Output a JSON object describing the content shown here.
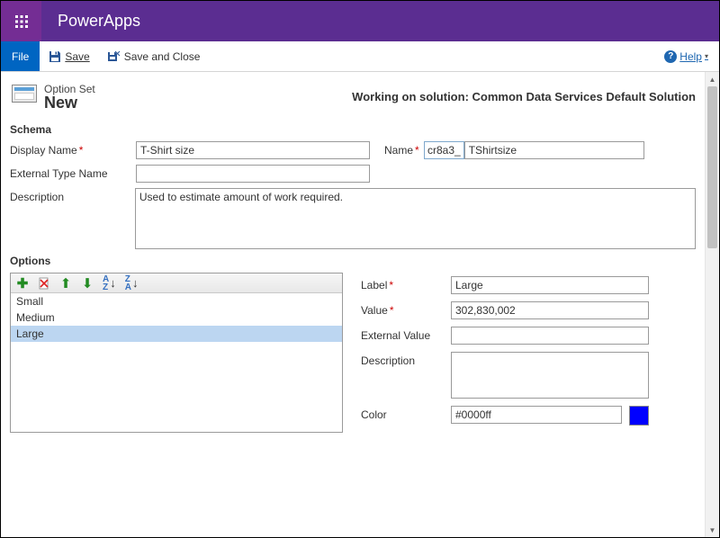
{
  "header": {
    "appTitle": "PowerApps"
  },
  "commandBar": {
    "file": "File",
    "save": "Save",
    "saveAndClose": "Save and Close",
    "help": "Help"
  },
  "pageHead": {
    "type": "Option Set",
    "name": "New",
    "solutionMessage": "Working on solution: Common Data Services Default Solution"
  },
  "schema": {
    "title": "Schema",
    "displayNameLabel": "Display Name",
    "displayNameValue": "T-Shirt size",
    "nameLabel": "Name",
    "namePrefix": "cr8a3_",
    "nameValue": "TShirtsize",
    "externalTypeLabel": "External Type Name",
    "externalTypeValue": "",
    "descriptionLabel": "Description",
    "descriptionValue": "Used to estimate amount of work required."
  },
  "options": {
    "title": "Options",
    "items": [
      "Small",
      "Medium",
      "Large"
    ],
    "selectedIndex": 2,
    "detail": {
      "labelLabel": "Label",
      "labelValue": "Large",
      "valueLabel": "Value",
      "valueValue": "302,830,002",
      "externalValueLabel": "External Value",
      "externalValueValue": "",
      "descriptionLabel": "Description",
      "descriptionValue": "",
      "colorLabel": "Color",
      "colorValue": "#0000ff"
    }
  }
}
